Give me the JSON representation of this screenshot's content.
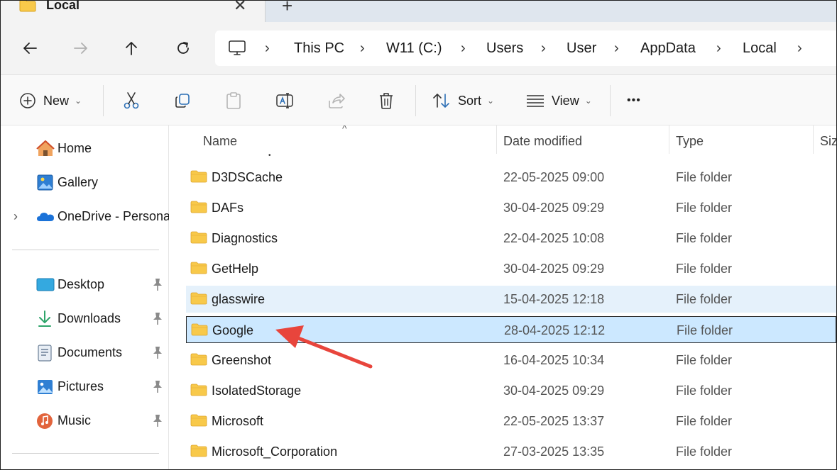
{
  "window": {
    "tab_title": "Local",
    "tab_close_glyph": "✕",
    "new_tab_glyph": "+"
  },
  "nav": {
    "breadcrumb": [
      "This PC",
      "W11 (C:)",
      "Users",
      "User",
      "AppData",
      "Local"
    ],
    "separator": "›"
  },
  "toolbar": {
    "new_label": "New",
    "sort_label": "Sort",
    "view_label": "View",
    "caret": "⌄",
    "more_glyph": "•••"
  },
  "sidebar": {
    "top_items": [
      {
        "label": "Home",
        "icon": "home-icon"
      },
      {
        "label": "Gallery",
        "icon": "gallery-icon"
      },
      {
        "label": "OneDrive - Persona",
        "icon": "onedrive-icon",
        "expand": "›"
      }
    ],
    "pinned_items": [
      {
        "label": "Desktop",
        "icon": "desktop-icon"
      },
      {
        "label": "Downloads",
        "icon": "downloads-icon"
      },
      {
        "label": "Documents",
        "icon": "documents-icon"
      },
      {
        "label": "Pictures",
        "icon": "pictures-icon"
      },
      {
        "label": "Music",
        "icon": "music-icon"
      }
    ]
  },
  "list": {
    "columns": {
      "name": "Name",
      "date": "Date modified",
      "type": "Type",
      "size": "Siz"
    },
    "sort_glyph": "^",
    "rows": [
      {
        "name": "D3DSCache",
        "date": "22-05-2025 09:00",
        "type": "File folder",
        "state": "normal"
      },
      {
        "name": "DAFs",
        "date": "30-04-2025 09:29",
        "type": "File folder",
        "state": "normal"
      },
      {
        "name": "Diagnostics",
        "date": "22-04-2025 10:08",
        "type": "File folder",
        "state": "normal"
      },
      {
        "name": "GetHelp",
        "date": "30-04-2025 09:29",
        "type": "File folder",
        "state": "normal"
      },
      {
        "name": "glasswire",
        "date": "15-04-2025 12:18",
        "type": "File folder",
        "state": "hover"
      },
      {
        "name": "Google",
        "date": "28-04-2025 12:12",
        "type": "File folder",
        "state": "selected"
      },
      {
        "name": "Greenshot",
        "date": "16-04-2025 10:34",
        "type": "File folder",
        "state": "normal"
      },
      {
        "name": "IsolatedStorage",
        "date": "30-04-2025 09:29",
        "type": "File folder",
        "state": "normal"
      },
      {
        "name": "Microsoft",
        "date": "22-05-2025 13:37",
        "type": "File folder",
        "state": "normal"
      },
      {
        "name": "Microsoft_Corporation",
        "date": "27-03-2025 13:35",
        "type": "File folder",
        "state": "normal"
      }
    ]
  },
  "colors": {
    "selected_bg": "#cce8ff",
    "hover_bg": "#e5f1fb",
    "folder": "#f8c94a",
    "annotation_arrow": "#e8453c"
  }
}
